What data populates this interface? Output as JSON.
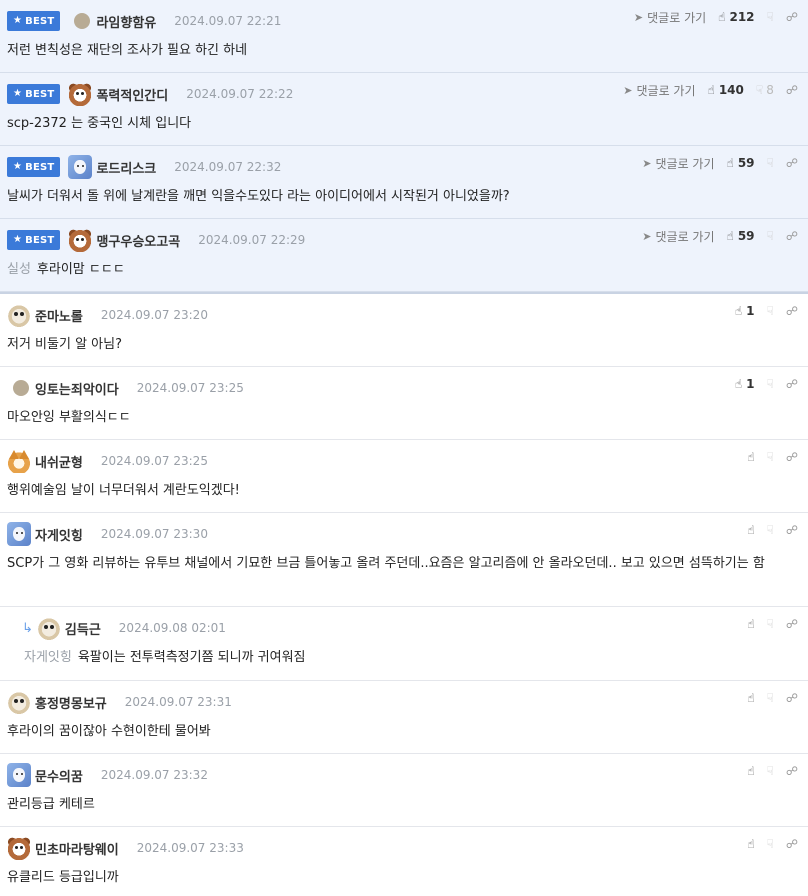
{
  "labels": {
    "best": "BEST",
    "goto": "댓글로 가기"
  },
  "icons": {
    "star": "★",
    "arrow": "➤",
    "thumbs_up": "👍",
    "thumbs_down": "👎",
    "share": "🔗",
    "reply": "↳"
  },
  "best_comments": [
    {
      "nick": "라임향함유",
      "date": "2024.09.07 22:21",
      "text": "저런 변칙성은 재단의 조사가 필요 하긴 하네",
      "up": "212",
      "down": ""
    },
    {
      "nick": "폭력적인간디",
      "date": "2024.09.07 22:22",
      "text": "scp-2372 는 중국인 시체 입니다",
      "up": "140",
      "down": "8"
    },
    {
      "nick": "로드리스크",
      "date": "2024.09.07 22:32",
      "text": "날씨가 더워서 돌 위에 날계란을 깨면 익을수도있다 라는 아이디어에서 시작된거 아니었을까?",
      "up": "59",
      "down": ""
    },
    {
      "nick": "맹구우승오고곡",
      "date": "2024.09.07 22:29",
      "ref": "실성",
      "text": "후라이맘 ㄷㄷㄷ",
      "up": "59",
      "down": ""
    }
  ],
  "comments": [
    {
      "nick": "준마노롤",
      "date": "2024.09.07 23:20",
      "text": "저거 비둘기 알 아님?",
      "up": "1"
    },
    {
      "nick": "잉토는죄악이다",
      "date": "2024.09.07 23:25",
      "text": "마오안잉 부활의식ㄷㄷ",
      "up": "1"
    },
    {
      "nick": "내쉬균형",
      "date": "2024.09.07 23:25",
      "text": "행위예술임 날이 너무더워서 계란도익겠다!",
      "up": ""
    },
    {
      "nick": "자게잇힝",
      "date": "2024.09.07 23:30",
      "text": "SCP가 그 영화 리뷰하는 유투브 채널에서 기묘한 브금 틀어놓고 올려 주던데..요즘은 알고리즘에 안 올라오던데.. 보고 있으면 섬뜩하기는 함",
      "up": ""
    },
    {
      "nick": "김득근",
      "date": "2024.09.08 02:01",
      "ref": "자게잇힝",
      "text": "육팔이는 전투력측정기쯤 되니까 귀여워짐",
      "up": ""
    },
    {
      "nick": "홍정명몽보규",
      "date": "2024.09.07 23:31",
      "text": "후라이의 꿈이잖아 수현이한테 물어봐",
      "up": ""
    },
    {
      "nick": "문수의꿈",
      "date": "2024.09.07 23:32",
      "text": "관리등급 케테르",
      "up": ""
    },
    {
      "nick": "민초마라탕웨이",
      "date": "2024.09.07 23:33",
      "text": "유클리드 등급입니까",
      "up": ""
    }
  ]
}
